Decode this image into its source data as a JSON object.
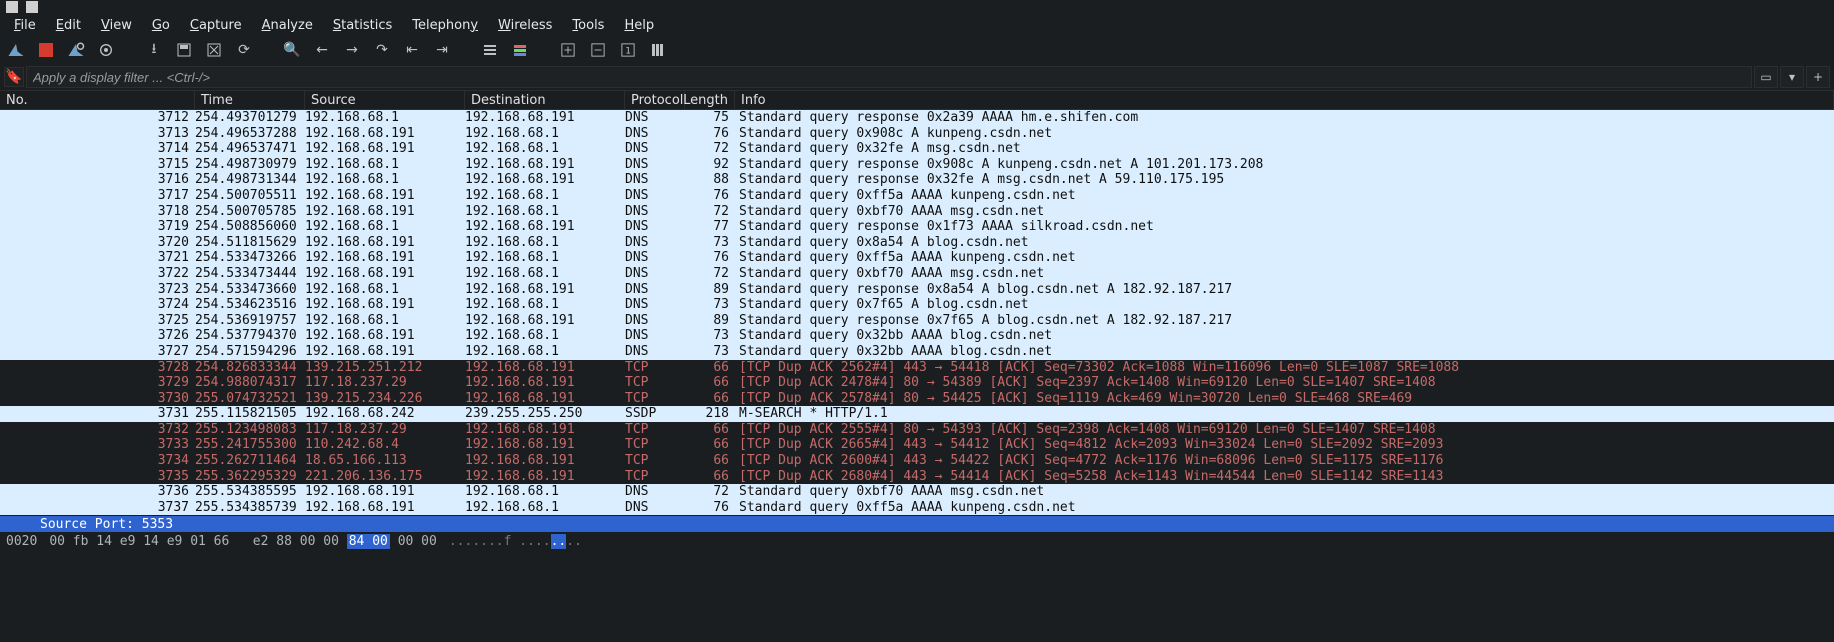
{
  "menu": {
    "file": "File",
    "edit": "Edit",
    "view": "View",
    "go": "Go",
    "capture": "Capture",
    "analyze": "Analyze",
    "statistics": "Statistics",
    "telephony": "Telephony",
    "wireless": "Wireless",
    "tools": "Tools",
    "help": "Help"
  },
  "filter": {
    "placeholder": "Apply a display filter ... <Ctrl-/>"
  },
  "columns": {
    "no": "No.",
    "time": "Time",
    "source": "Source",
    "destination": "Destination",
    "protocol": "Protocol",
    "length": "Length",
    "info": "Info"
  },
  "packets": [
    {
      "no": "3712",
      "time": "254.493701279",
      "src": "192.168.68.1",
      "dst": "192.168.68.191",
      "prot": "DNS",
      "len": "75",
      "info": "Standard query response 0x2a39 AAAA hm.e.shifen.com",
      "style": "dns"
    },
    {
      "no": "3713",
      "time": "254.496537288",
      "src": "192.168.68.191",
      "dst": "192.168.68.1",
      "prot": "DNS",
      "len": "76",
      "info": "Standard query 0x908c A kunpeng.csdn.net",
      "style": "dns"
    },
    {
      "no": "3714",
      "time": "254.496537471",
      "src": "192.168.68.191",
      "dst": "192.168.68.1",
      "prot": "DNS",
      "len": "72",
      "info": "Standard query 0x32fe A msg.csdn.net",
      "style": "dns"
    },
    {
      "no": "3715",
      "time": "254.498730979",
      "src": "192.168.68.1",
      "dst": "192.168.68.191",
      "prot": "DNS",
      "len": "92",
      "info": "Standard query response 0x908c A kunpeng.csdn.net A 101.201.173.208",
      "style": "dns"
    },
    {
      "no": "3716",
      "time": "254.498731344",
      "src": "192.168.68.1",
      "dst": "192.168.68.191",
      "prot": "DNS",
      "len": "88",
      "info": "Standard query response 0x32fe A msg.csdn.net A 59.110.175.195",
      "style": "dns"
    },
    {
      "no": "3717",
      "time": "254.500705511",
      "src": "192.168.68.191",
      "dst": "192.168.68.1",
      "prot": "DNS",
      "len": "76",
      "info": "Standard query 0xff5a AAAA kunpeng.csdn.net",
      "style": "dns"
    },
    {
      "no": "3718",
      "time": "254.500705785",
      "src": "192.168.68.191",
      "dst": "192.168.68.1",
      "prot": "DNS",
      "len": "72",
      "info": "Standard query 0xbf70 AAAA msg.csdn.net",
      "style": "dns"
    },
    {
      "no": "3719",
      "time": "254.508856060",
      "src": "192.168.68.1",
      "dst": "192.168.68.191",
      "prot": "DNS",
      "len": "77",
      "info": "Standard query response 0x1f73 AAAA silkroad.csdn.net",
      "style": "dns"
    },
    {
      "no": "3720",
      "time": "254.511815629",
      "src": "192.168.68.191",
      "dst": "192.168.68.1",
      "prot": "DNS",
      "len": "73",
      "info": "Standard query 0x8a54 A blog.csdn.net",
      "style": "dns"
    },
    {
      "no": "3721",
      "time": "254.533473266",
      "src": "192.168.68.191",
      "dst": "192.168.68.1",
      "prot": "DNS",
      "len": "76",
      "info": "Standard query 0xff5a AAAA kunpeng.csdn.net",
      "style": "dns"
    },
    {
      "no": "3722",
      "time": "254.533473444",
      "src": "192.168.68.191",
      "dst": "192.168.68.1",
      "prot": "DNS",
      "len": "72",
      "info": "Standard query 0xbf70 AAAA msg.csdn.net",
      "style": "dns"
    },
    {
      "no": "3723",
      "time": "254.533473660",
      "src": "192.168.68.1",
      "dst": "192.168.68.191",
      "prot": "DNS",
      "len": "89",
      "info": "Standard query response 0x8a54 A blog.csdn.net A 182.92.187.217",
      "style": "dns"
    },
    {
      "no": "3724",
      "time": "254.534623516",
      "src": "192.168.68.191",
      "dst": "192.168.68.1",
      "prot": "DNS",
      "len": "73",
      "info": "Standard query 0x7f65 A blog.csdn.net",
      "style": "dns"
    },
    {
      "no": "3725",
      "time": "254.536919757",
      "src": "192.168.68.1",
      "dst": "192.168.68.191",
      "prot": "DNS",
      "len": "89",
      "info": "Standard query response 0x7f65 A blog.csdn.net A 182.92.187.217",
      "style": "dns"
    },
    {
      "no": "3726",
      "time": "254.537794370",
      "src": "192.168.68.191",
      "dst": "192.168.68.1",
      "prot": "DNS",
      "len": "73",
      "info": "Standard query 0x32bb AAAA blog.csdn.net",
      "style": "dns"
    },
    {
      "no": "3727",
      "time": "254.571594296",
      "src": "192.168.68.191",
      "dst": "192.168.68.1",
      "prot": "DNS",
      "len": "73",
      "info": "Standard query 0x32bb AAAA blog.csdn.net",
      "style": "dns"
    },
    {
      "no": "3728",
      "time": "254.826833344",
      "src": "139.215.251.212",
      "dst": "192.168.68.191",
      "prot": "TCP",
      "len": "66",
      "info": "[TCP Dup ACK 2562#4] 443 → 54418 [ACK] Seq=73302 Ack=1088 Win=116096 Len=0 SLE=1087 SRE=1088",
      "style": "tcp"
    },
    {
      "no": "3729",
      "time": "254.988074317",
      "src": "117.18.237.29",
      "dst": "192.168.68.191",
      "prot": "TCP",
      "len": "66",
      "info": "[TCP Dup ACK 2478#4] 80 → 54389 [ACK] Seq=2397 Ack=1408 Win=69120 Len=0 SLE=1407 SRE=1408",
      "style": "tcp"
    },
    {
      "no": "3730",
      "time": "255.074732521",
      "src": "139.215.234.226",
      "dst": "192.168.68.191",
      "prot": "TCP",
      "len": "66",
      "info": "[TCP Dup ACK 2578#4] 80 → 54425 [ACK] Seq=1119 Ack=469 Win=30720 Len=0 SLE=468 SRE=469",
      "style": "tcp"
    },
    {
      "no": "3731",
      "time": "255.115821505",
      "src": "192.168.68.242",
      "dst": "239.255.255.250",
      "prot": "SSDP",
      "len": "218",
      "info": "M-SEARCH * HTTP/1.1",
      "style": "ssdp"
    },
    {
      "no": "3732",
      "time": "255.123498083",
      "src": "117.18.237.29",
      "dst": "192.168.68.191",
      "prot": "TCP",
      "len": "66",
      "info": "[TCP Dup ACK 2555#4] 80 → 54393 [ACK] Seq=2398 Ack=1408 Win=69120 Len=0 SLE=1407 SRE=1408",
      "style": "tcp"
    },
    {
      "no": "3733",
      "time": "255.241755300",
      "src": "110.242.68.4",
      "dst": "192.168.68.191",
      "prot": "TCP",
      "len": "66",
      "info": "[TCP Dup ACK 2665#4] 443 → 54412 [ACK] Seq=4812 Ack=2093 Win=33024 Len=0 SLE=2092 SRE=2093",
      "style": "tcp"
    },
    {
      "no": "3734",
      "time": "255.262711464",
      "src": "18.65.166.113",
      "dst": "192.168.68.191",
      "prot": "TCP",
      "len": "66",
      "info": "[TCP Dup ACK 2600#4] 443 → 54422 [ACK] Seq=4772 Ack=1176 Win=68096 Len=0 SLE=1175 SRE=1176",
      "style": "tcp"
    },
    {
      "no": "3735",
      "time": "255.362295329",
      "src": "221.206.136.175",
      "dst": "192.168.68.191",
      "prot": "TCP",
      "len": "66",
      "info": "[TCP Dup ACK 2680#4] 443 → 54414 [ACK] Seq=5258 Ack=1143 Win=44544 Len=0 SLE=1142 SRE=1143",
      "style": "tcp"
    },
    {
      "no": "3736",
      "time": "255.534385595",
      "src": "192.168.68.191",
      "dst": "192.168.68.1",
      "prot": "DNS",
      "len": "72",
      "info": "Standard query 0xbf70 AAAA msg.csdn.net",
      "style": "dns"
    },
    {
      "no": "3737",
      "time": "255.534385739",
      "src": "192.168.68.191",
      "dst": "192.168.68.1",
      "prot": "DNS",
      "len": "76",
      "info": "Standard query 0xff5a AAAA kunpeng.csdn.net",
      "style": "dns"
    }
  ],
  "detail": {
    "selected_line": "Source Port: 5353"
  },
  "hex": {
    "offset": "0020",
    "bytes_pre": "00 fb 14 e9 14 e9 01 66   e2 88 00 00 ",
    "bytes_hl": "84 00",
    "bytes_post": " 00 00",
    "ascii_pre": ".......f ....",
    "ascii_hl": "..",
    "ascii_post": ".."
  }
}
